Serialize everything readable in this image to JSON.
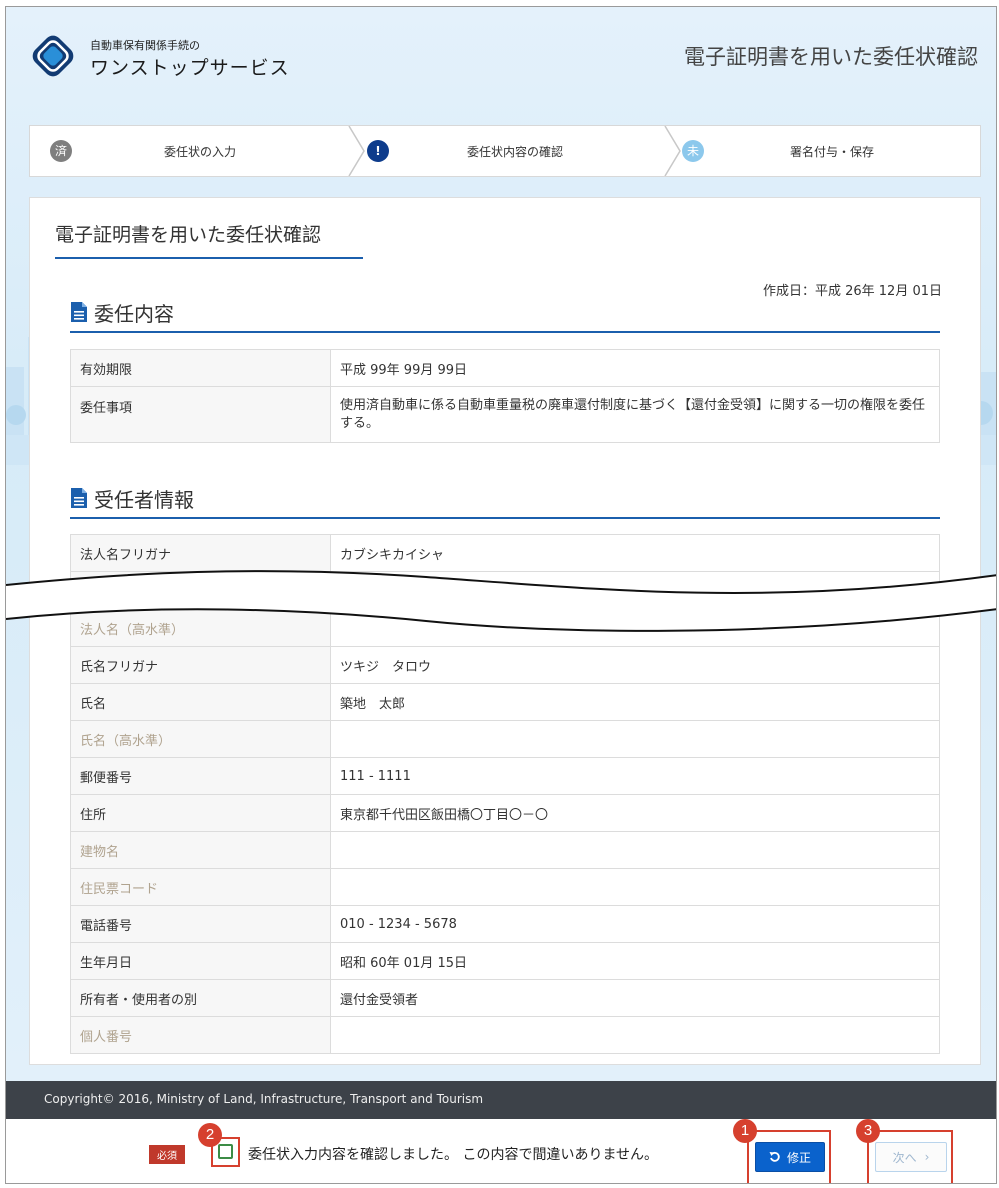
{
  "header": {
    "logo_small": "自動車保有関係手続の",
    "logo_big": "ワンストップサービス",
    "title": "電子証明書を用いた委任状確認"
  },
  "steps": [
    {
      "badge": "済",
      "label": "委任状の入力",
      "color": "#7f7f7f"
    },
    {
      "badge": "!",
      "label": "委任状内容の確認",
      "color": "#0e3c8c"
    },
    {
      "badge": "未",
      "label": "署名付与・保存",
      "color": "#8cc8ec"
    }
  ],
  "panel": {
    "title": "電子証明書を用いた委任状確認",
    "created": "作成日：平成 26年 12月 01日"
  },
  "section1": {
    "heading": "委任内容",
    "rows": [
      {
        "key": "有効期限",
        "value": "平成 99年 99月 99日"
      },
      {
        "key": "委任事項",
        "value": "使用済自動車に係る自動車重量税の廃車還付制度に基づく【還付金受領】に関する一切の権限を委任する。"
      }
    ]
  },
  "section2": {
    "heading": "受任者情報",
    "rows_top": [
      {
        "key": "法人名フリガナ",
        "value": "カブシキカイシャ"
      }
    ],
    "rows_bottom": [
      {
        "key": "法人名（高水準）",
        "value": ""
      },
      {
        "key": "氏名フリガナ",
        "value": "ツキジ　タロウ"
      },
      {
        "key": "氏名",
        "value": "築地　太郎"
      },
      {
        "key": "氏名（高水準）",
        "value": ""
      },
      {
        "key": "郵便番号",
        "value": "111 - 1111"
      },
      {
        "key": "住所",
        "value": "東京都千代田区飯田橋〇丁目〇－〇"
      },
      {
        "key": "建物名",
        "value": ""
      },
      {
        "key": "住民票コード",
        "value": ""
      },
      {
        "key": "電話番号",
        "value": "010 - 1234 - 5678"
      },
      {
        "key": "生年月日",
        "value": "昭和 60年 01月 15日"
      },
      {
        "key": "所有者・使用者の別",
        "value": "還付金受領者"
      },
      {
        "key": "個人番号",
        "value": ""
      }
    ]
  },
  "footer": {
    "copyright": "Copyright© 2016, Ministry of Land, Infrastructure, Transport and Tourism"
  },
  "bottom": {
    "required": "必須",
    "confirm_text": "委任状入力内容を確認しました。 この内容で間違いありません。",
    "fix_label": "修正",
    "next_label": "次へ",
    "callouts": [
      "1",
      "2",
      "3"
    ]
  },
  "colors": {
    "accent": "#1b5fad",
    "primary_button": "#0a62cc",
    "callout": "#d6402e",
    "footer_bg": "#3d4249"
  }
}
